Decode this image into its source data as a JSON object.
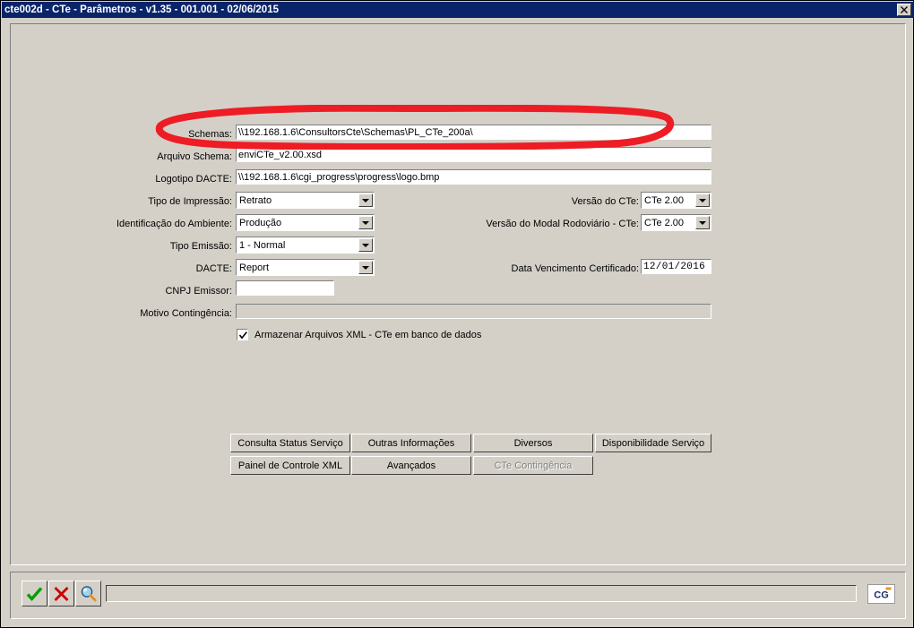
{
  "window": {
    "title": "cte002d - CTe - Parâmetros - v1.35 - 001.001 - 02/06/2015",
    "close_label": "✕"
  },
  "form": {
    "fields": [
      {
        "label": "Schemas:",
        "value": "\\\\192.168.1.6\\ConsultorsCte\\Schemas\\PL_CTe_200a\\"
      },
      {
        "label": "Arquivo Schema:",
        "value": "enviCTe_v2.00.xsd"
      },
      {
        "label": "Logotipo DACTE:",
        "value": "\\\\192.168.1.6\\cgi_progress\\progress\\logo.bmp"
      },
      {
        "label": "Motivo Contingência:",
        "value": ""
      },
      {
        "label": "CNPJ Emissor:",
        "value": ""
      }
    ],
    "combos_left": [
      {
        "label": "Tipo de Impressão:",
        "value": "Retrato"
      },
      {
        "label": "Identificação do Ambiente:",
        "value": "Produção"
      },
      {
        "label": "Tipo Emissão:",
        "value": "1 - Normal"
      },
      {
        "label": "DACTE:",
        "value": "Report"
      }
    ],
    "combos_right": [
      {
        "label": "Versão do CTe:",
        "value": "CTe 2.00"
      },
      {
        "label": "Versão do Modal Rodoviário - CTe:",
        "value": "CTe 2.00"
      }
    ],
    "date_field": {
      "label": "Data Vencimento Certificado:",
      "value": "12/01/2016"
    },
    "checkbox": {
      "label": "Armazenar Arquivos XML - CTe em banco de dados",
      "checked": true
    }
  },
  "buttons": [
    {
      "label": "Consulta Status Serviço",
      "disabled": false
    },
    {
      "label": "Outras Informações",
      "disabled": false
    },
    {
      "label": "Diversos",
      "disabled": false
    },
    {
      "label": "Disponibilidade Serviço",
      "disabled": false
    },
    {
      "label": "Painel de Controle XML",
      "disabled": false
    },
    {
      "label": "Avançados",
      "disabled": false
    },
    {
      "label": "CTe Contingência",
      "disabled": true
    }
  ],
  "toolbar": {
    "confirm_icon": "check-icon",
    "cancel_icon": "x-icon",
    "search_icon": "magnifier-icon",
    "status_value": "",
    "logo_text": "CG"
  },
  "annotation": {
    "shape": "ellipse-highlight",
    "color": "#ee1c24",
    "target": "Schemas:"
  }
}
